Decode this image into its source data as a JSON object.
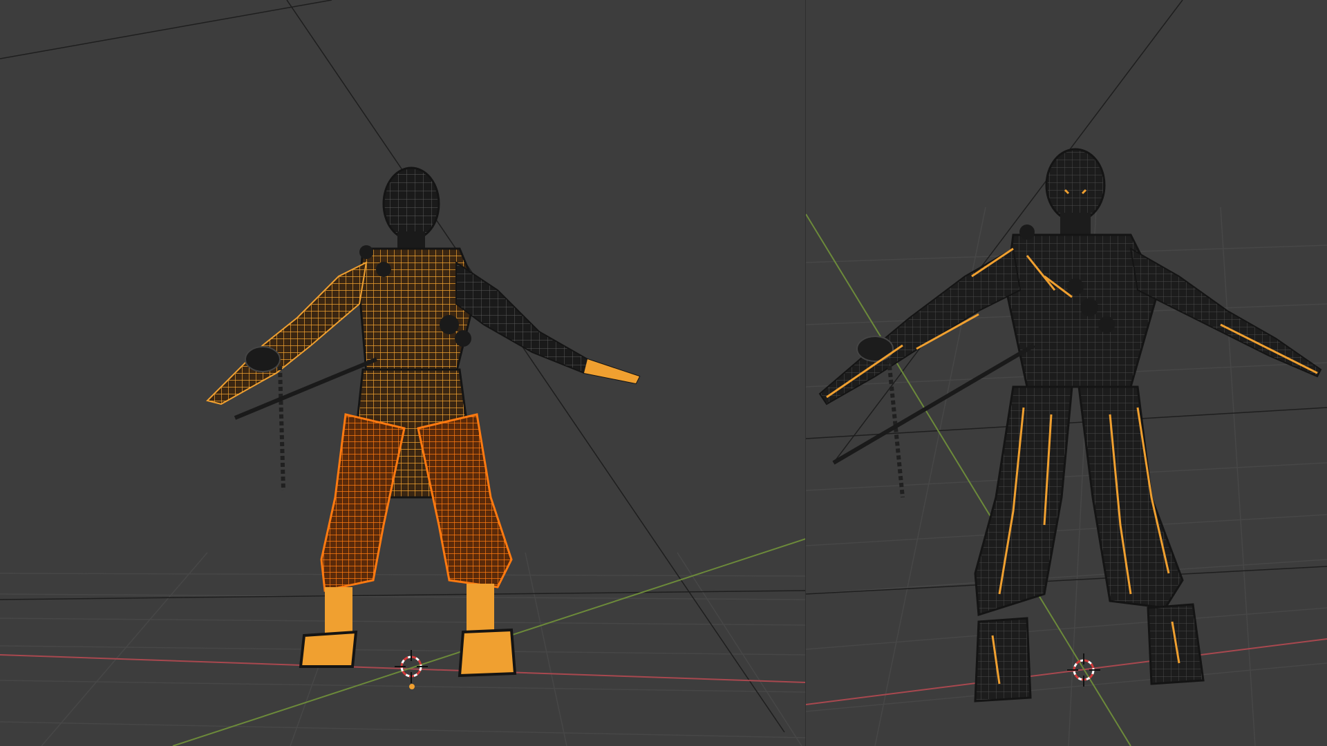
{
  "app": {
    "kind": "3d-editor",
    "view": "wireframe"
  },
  "theme": {
    "viewport_bg": "#3d3d3d",
    "grid_line": "#474747",
    "axis_x": "#a9484f",
    "axis_y": "#6c8a3a",
    "wire_dark": "#141414",
    "wire_selected": "#f0a030",
    "wire_active": "#ff7a10",
    "cursor_ring": "#ffffff",
    "cursor_dash": "#d23a3a"
  },
  "viewports": [
    {
      "id": "left",
      "selection": "body-and-pants",
      "cursor-icon": "3d-cursor-icon"
    },
    {
      "id": "right",
      "selection": "edge-seams",
      "cursor-icon": "3d-cursor-icon"
    }
  ]
}
